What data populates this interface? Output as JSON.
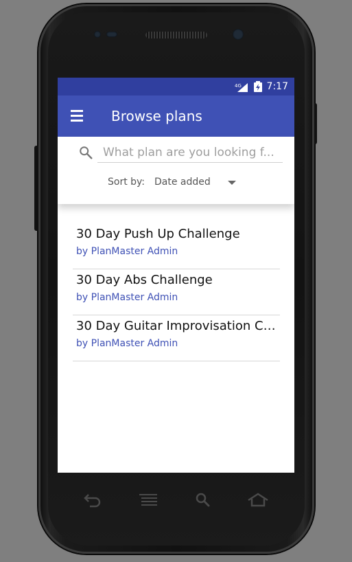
{
  "status_bar": {
    "network": "4G",
    "time": "7:17"
  },
  "app_bar": {
    "title": "Browse plans",
    "menu_icon": "hamburger-menu-icon"
  },
  "search": {
    "placeholder": "What plan are you looking f...",
    "value": "",
    "icon": "search-icon"
  },
  "sort": {
    "label": "Sort by:",
    "selected": "Date added"
  },
  "plans": [
    {
      "name": "30 Day Push Up Challenge",
      "author": "by PlanMaster Admin"
    },
    {
      "name": "30 Day Abs Challenge",
      "author": "by PlanMaster Admin"
    },
    {
      "name": "30 Day Guitar Improvisation Ch...",
      "author": "by PlanMaster Admin"
    }
  ],
  "nav_buttons": [
    "back-icon",
    "menu-lines-icon",
    "search-icon",
    "home-icon"
  ],
  "colors": {
    "primary": "#3f51b5",
    "primary_dark": "#303f9f",
    "author_text": "#3f51b5"
  }
}
